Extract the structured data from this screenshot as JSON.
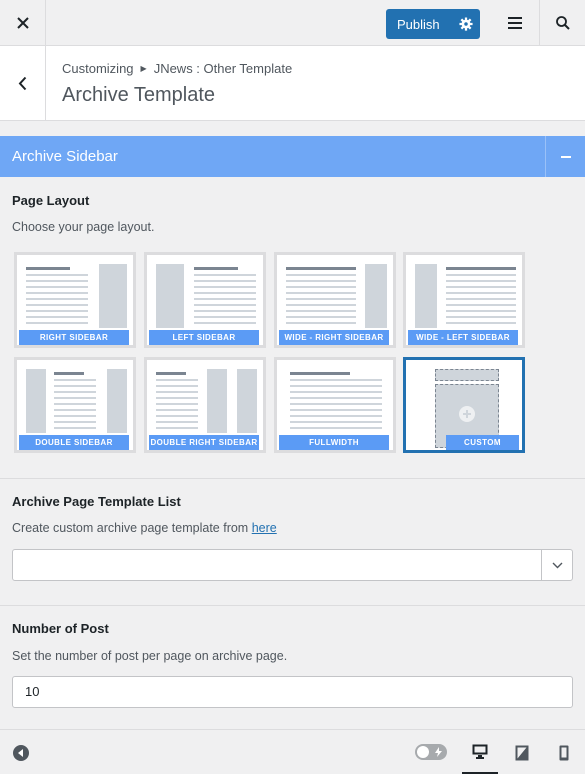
{
  "topbar": {
    "publish_label": "Publish"
  },
  "header": {
    "crumb_root": "Customizing",
    "crumb_parent": "JNews : Other Template",
    "title": "Archive Template"
  },
  "panel": {
    "title": "Archive Sidebar",
    "page_layout": {
      "title": "Page Layout",
      "description": "Choose your page layout.",
      "options": [
        {
          "label": "RIGHT SIDEBAR"
        },
        {
          "label": "LEFT SIDEBAR"
        },
        {
          "label": "WIDE - RIGHT SIDEBAR"
        },
        {
          "label": "WIDE - LEFT SIDEBAR"
        },
        {
          "label": "DOUBLE SIDEBAR"
        },
        {
          "label": "DOUBLE RIGHT SIDEBAR"
        },
        {
          "label": "FULLWIDTH"
        },
        {
          "label": "CUSTOM",
          "selected": true
        }
      ]
    },
    "template_list": {
      "title": "Archive Page Template List",
      "description": "Create custom archive page template from",
      "link_text": "here",
      "value": ""
    },
    "number_of_post": {
      "title": "Number of Post",
      "description": "Set the number of post per page on archive page.",
      "value": "10"
    }
  },
  "footer": {
    "icons": [
      "collapse-sidebar-icon",
      "toggle-icon",
      "desktop-icon",
      "tablet-icon",
      "mobile-icon"
    ],
    "active_device": "desktop"
  },
  "colors": {
    "accent": "#2271b1",
    "panel_header": "#6fa7f5",
    "layout_label": "#5b9bf5"
  }
}
